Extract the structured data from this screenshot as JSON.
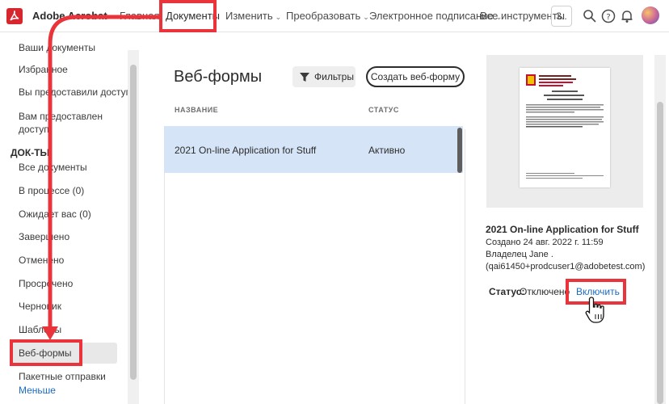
{
  "header": {
    "brand": "Adobe Acrobat",
    "nav": [
      {
        "label": "Главная",
        "dropdown": false
      },
      {
        "label": "Документы",
        "dropdown": false
      },
      {
        "label": "Изменить",
        "dropdown": true
      },
      {
        "label": "Преобразовать",
        "dropdown": true
      },
      {
        "label": "Электронное подписание",
        "dropdown": true
      },
      {
        "label": "Все инструменты",
        "dropdown": false
      }
    ],
    "toolbar_box": "3..",
    "icons": [
      "search-icon",
      "help-icon",
      "bell-icon",
      "avatar"
    ]
  },
  "sidebar": {
    "items_top": [
      "Ваши документы",
      "Избранное",
      "Вы предоставили доступ",
      "Вам предоставлен доступ"
    ],
    "section": "ДОК-ТЫ",
    "items": [
      "Все документы",
      "В процессе (0)",
      "Ожидает вас (0)",
      "Завершено",
      "Отменено",
      "Просрочено",
      "Черновик",
      "Шаблоны",
      "Веб-формы",
      "Пакетные отправки"
    ],
    "selected": "Веб-формы",
    "more": "Меньше"
  },
  "main": {
    "title": "Веб-формы",
    "filters_button": "Фильтры",
    "create_button": "Создать веб-форму",
    "columns": {
      "name": "НАЗВАНИЕ",
      "status": "СТАТУС"
    },
    "rows": [
      {
        "name": "2021 On-line Application for Stuff",
        "status": "Активно"
      }
    ]
  },
  "panel": {
    "doc_title": "2021 On-line Application for Stuff",
    "created": "Создано 24 авг. 2022 г. 11:59",
    "owner": "Владелец Jane .",
    "email": "(qai61450+prodcuser1@adobetest.com)",
    "status_label": "Статус:",
    "status_value": "Отключено",
    "enable_link": "Включить"
  },
  "colors": {
    "accent_red": "#e8343a",
    "link_blue": "#1c6bc2",
    "row_selected": "#d5e4f7",
    "adobe_red": "#d7262d"
  }
}
